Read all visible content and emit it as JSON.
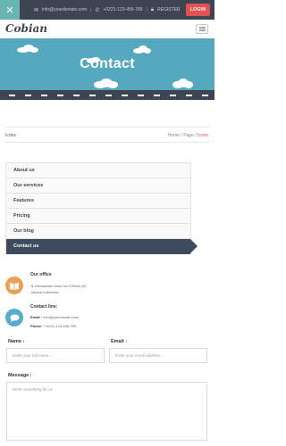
{
  "topbar": {
    "email": "info@yourdomain.com",
    "phone": "+0221-123-456-789",
    "register": "REGISTER",
    "login": "LOGIN"
  },
  "header": {
    "logo": "Cobian",
    "menu_icon": "hamburger-icon"
  },
  "hero": {
    "title": "Contact"
  },
  "breadcrumb": {
    "page_title": "Icons",
    "trail": [
      "Home",
      "Page",
      "Icons"
    ],
    "separator": "/"
  },
  "sidemenu": {
    "items": [
      "About us",
      "Our services",
      "Features",
      "Pricing",
      "Our blog",
      "Contact us"
    ],
    "active_index": 5
  },
  "office": {
    "title": "Our office",
    "line1": "JL.Kemacetan timur No.3 Block QC",
    "line2": "Jakarta Indonesia"
  },
  "contact_line": {
    "title": "Contact line:",
    "email_label": "Email :",
    "email_value": "info@yourdomain.com",
    "phone_label": "Phone :",
    "phone_value": "+0221-123-456-789"
  },
  "form": {
    "name_label": "Name :",
    "name_placeholder": "Enter your full name...",
    "email_label": "Email :",
    "email_placeholder": "Enter your email address...",
    "message_label": "Message :",
    "message_placeholder": "Write something for us ..."
  },
  "colors": {
    "topbar": "#3d4452",
    "accent": "#e05353",
    "teal": "#68b5b2",
    "hero": "#55a8bd",
    "menu_active": "#3e4a5d",
    "office_icon": "#e8a256",
    "contact_icon": "#5aa9cf"
  }
}
